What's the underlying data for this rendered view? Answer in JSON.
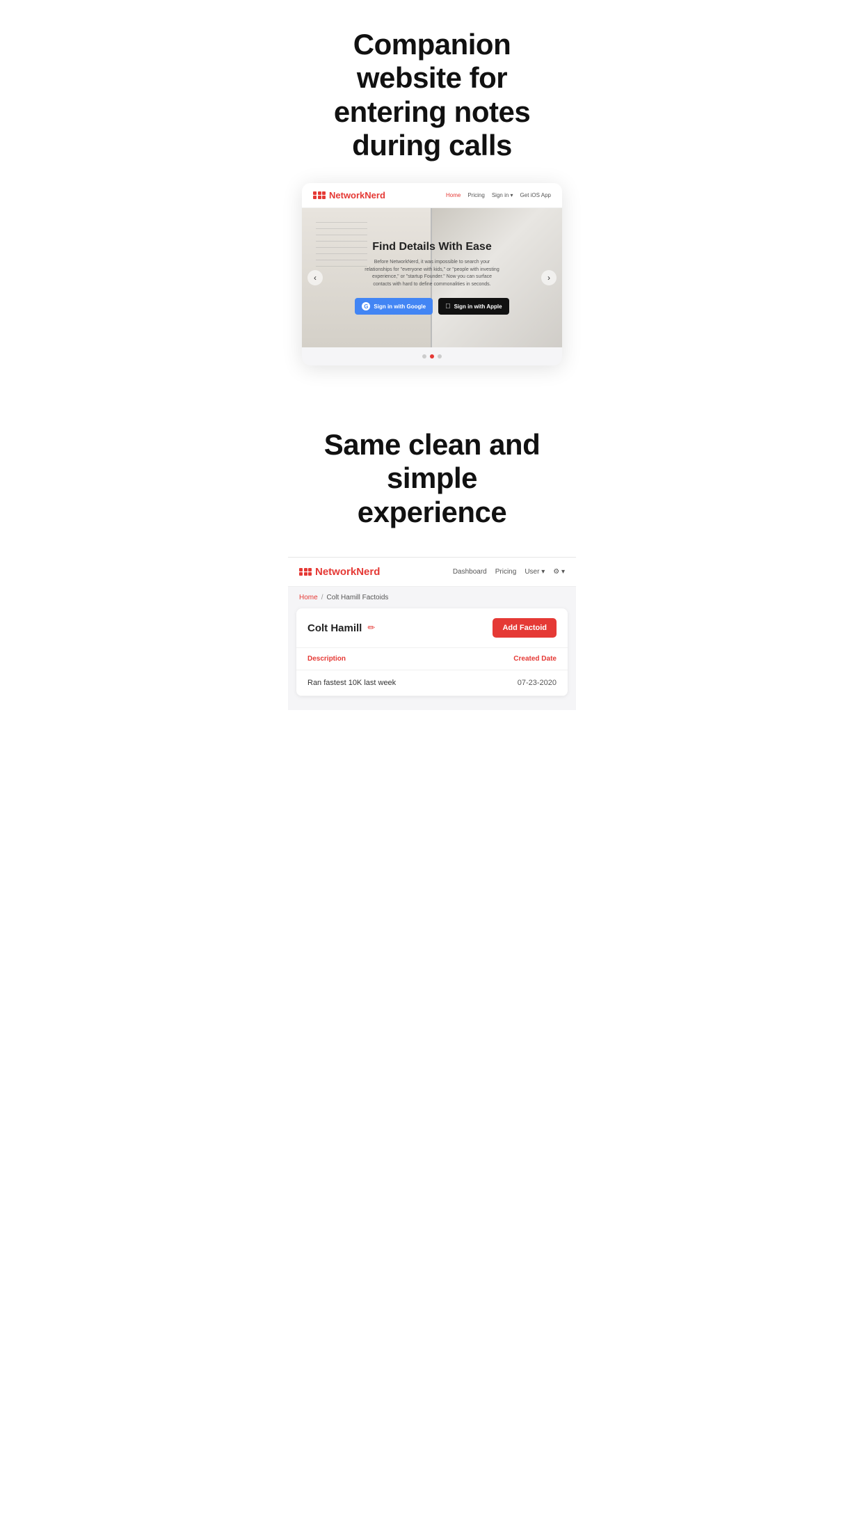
{
  "page": {
    "hero": {
      "title_line1": "Companion website for",
      "title_line2": "entering notes during calls"
    },
    "website_screenshot": {
      "nav": {
        "logo_word1": "Network",
        "logo_word2": "Nerd",
        "links": [
          {
            "label": "Home",
            "active": true
          },
          {
            "label": "Pricing",
            "active": false
          },
          {
            "label": "Sign in ▾",
            "active": false
          },
          {
            "label": "Get iOS App",
            "active": false
          }
        ]
      },
      "carousel": {
        "title": "Find Details With Ease",
        "description": "Before NetworkNerd, it was impossible to search your relationships for \"everyone with kids,\" or \"people with investing experience,\" or \"startup Founder.\" Now you can surface contacts with hard to define commonalities in seconds.",
        "btn_google": "Sign in with Google",
        "btn_apple": "Sign in with Apple",
        "dots": [
          {
            "active": false
          },
          {
            "active": true
          },
          {
            "active": false
          }
        ],
        "prev_arrow": "‹",
        "next_arrow": "›"
      }
    },
    "section2": {
      "title_line1": "Same clean and simple",
      "title_line2": "experience"
    },
    "dashboard_screenshot": {
      "nav": {
        "logo_word1": "Network",
        "logo_word2": "Nerd",
        "links": [
          {
            "label": "Dashboard"
          },
          {
            "label": "Pricing"
          },
          {
            "label": "User ▾"
          },
          {
            "label": "⚙ ▾"
          }
        ]
      },
      "breadcrumb": {
        "home": "Home",
        "separator": "/",
        "current": "Colt Hamill Factoids"
      },
      "card": {
        "person_name": "Colt Hamill",
        "edit_icon": "✏",
        "add_button": "Add Factoid",
        "table": {
          "col_description": "Description",
          "col_date": "Created Date",
          "rows": [
            {
              "description": "Ran fastest 10K last week",
              "date": "07-23-2020"
            }
          ]
        }
      }
    }
  }
}
